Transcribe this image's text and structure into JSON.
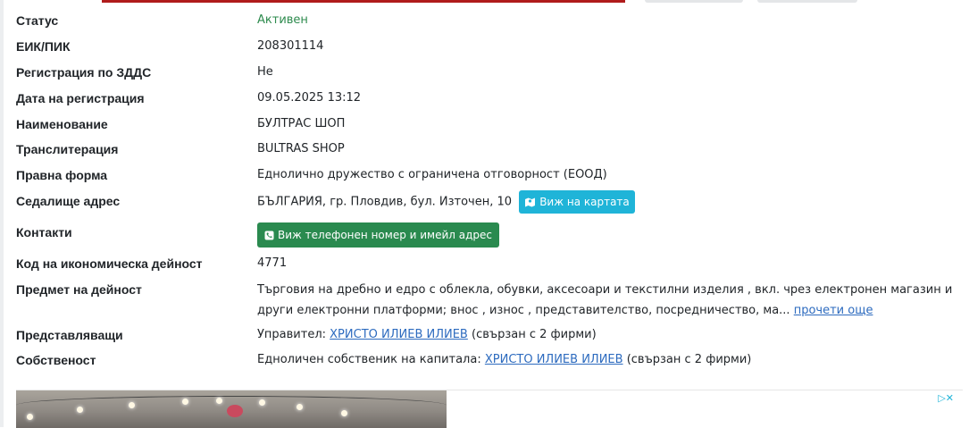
{
  "fields": [
    {
      "label": "Статус",
      "value": "Активен"
    },
    {
      "label": "ЕИК/ПИК",
      "value": "208301114"
    },
    {
      "label": "Регистрация по ЗДДС",
      "value": "Не"
    },
    {
      "label": "Дата на регистрация",
      "value": "09.05.2025 13:12"
    },
    {
      "label": "Наименование",
      "value": "БУЛТРАС ШОП"
    },
    {
      "label": "Транслитерация",
      "value": "BULTRAS SHOP"
    },
    {
      "label": "Правна форма",
      "value": "Еднолично дружество с ограничена отговорност (ЕООД)"
    },
    {
      "label": "Седалище адрес",
      "value": "БЪЛГАРИЯ, гр. Пловдив, бул. Източен, 10"
    },
    {
      "label": "Контакти"
    },
    {
      "label": "Код на икономическа дейност",
      "value": "4771"
    },
    {
      "label": "Предмет на дейност",
      "value": "Търговия на дребно и едро с облекла, обувки, аксесоари и текстилни изделия , вкл. чрез електронен магазин и други електронни платформи; внос , износ , представителство, посредничество, ма..."
    },
    {
      "label": "Представляващи"
    },
    {
      "label": "Собственост"
    }
  ],
  "map_button": "Виж на картата",
  "phone_button": "Виж телефонен номер и имейл адрес",
  "read_more": "прочети още",
  "representatives": {
    "prefix": "Управител:",
    "name": "ХРИСТО ИЛИЕВ ИЛИЕВ",
    "suffix": "(свързан с 2 фирми)"
  },
  "ownership": {
    "prefix": "Едноличен собственик на капитала:",
    "name": "ХРИСТО ИЛИЕВ ИЛИЕВ",
    "suffix": "(свързан с 2 фирми)"
  },
  "ad_choice_icon": "adchoices-icon",
  "colors": {
    "status": "#2e8b4e",
    "map_button": "#1fb4d8",
    "phone_button": "#2a8a4f",
    "link": "#2d6bbf"
  }
}
